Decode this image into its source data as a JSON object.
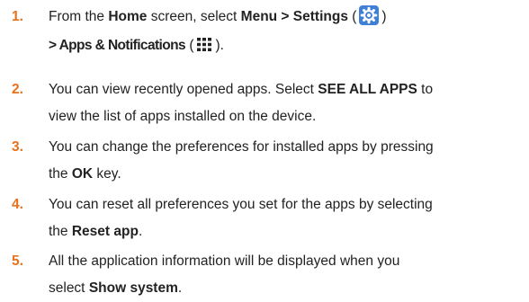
{
  "colors": {
    "step_number": "#E8711C",
    "text": "#222222",
    "settings_icon_bg": "#3F7FD6"
  },
  "steps": [
    {
      "number": "1.",
      "t1": "From the ",
      "b1": "Home",
      "t2": " screen, select ",
      "b2": "Menu > Settings",
      "t3": " (",
      "icon1": "settings-gear-icon",
      "t4": ")",
      "b3": "> Apps & Notifications",
      "t5": " (",
      "icon2": "app-grid-icon",
      "t6": ")."
    },
    {
      "number": "2.",
      "t1": "You can view recently opened apps. Select ",
      "b1": "SEE ALL APPS",
      "t2": " to",
      "t3": "view the list of apps installed on the device."
    },
    {
      "number": "3.",
      "t1": "You can change the preferences for installed apps by pressing",
      "t2": "the ",
      "b1": "OK",
      "t3": " key."
    },
    {
      "number": "4.",
      "t1": "You can reset all preferences you set for the apps by selecting",
      "t2": "the ",
      "b1": "Reset app",
      "t3": "."
    },
    {
      "number": "5.",
      "t1": "All the application information will be displayed when you",
      "t2": "select ",
      "b1": "Show system",
      "t3": "."
    }
  ]
}
